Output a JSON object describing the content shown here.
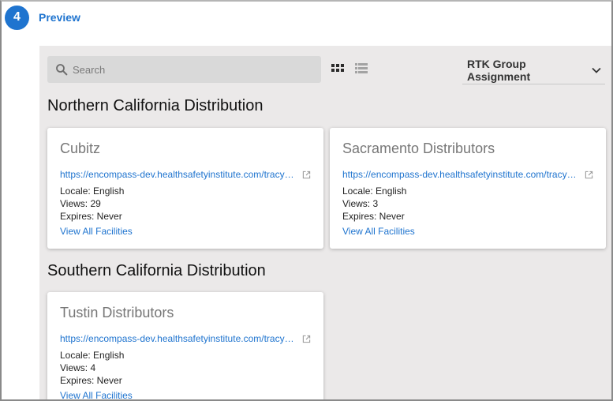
{
  "step": {
    "number": "4",
    "title": "Preview"
  },
  "toolbar": {
    "search_placeholder": "Search",
    "group_select_value": "RTK Group Assignment"
  },
  "sections": [
    {
      "title": "Northern California Distribution",
      "cards": [
        {
          "title": "Cubitz",
          "url": "https://encompass-dev.healthsafetyinstitute.com/tracy…",
          "locale": "Locale: English",
          "views": "Views: 29",
          "expires": "Expires: Never",
          "link": "View All Facilities"
        },
        {
          "title": "Sacramento Distributors",
          "url": "https://encompass-dev.healthsafetyinstitute.com/tracy…",
          "locale": "Locale: English",
          "views": "Views: 3",
          "expires": "Expires: Never",
          "link": "View All Facilities"
        }
      ]
    },
    {
      "title": "Southern California Distribution",
      "cards": [
        {
          "title": "Tustin Distributors",
          "url": "https://encompass-dev.healthsafetyinstitute.com/tracy…",
          "locale": "Locale: English",
          "views": "Views: 4",
          "expires": "Expires: Never",
          "link": "View All Facilities"
        }
      ]
    }
  ],
  "icons": {
    "search": "search-icon",
    "grid_view": "grid-view-icon",
    "list_view": "list-view-icon",
    "dropdown": "chevron-down-icon",
    "external": "external-link-icon"
  },
  "colors": {
    "accent": "#1f74cf",
    "panel_bg": "#ebe9e9",
    "search_bg": "#d9d9d9",
    "card_title": "#777777"
  }
}
